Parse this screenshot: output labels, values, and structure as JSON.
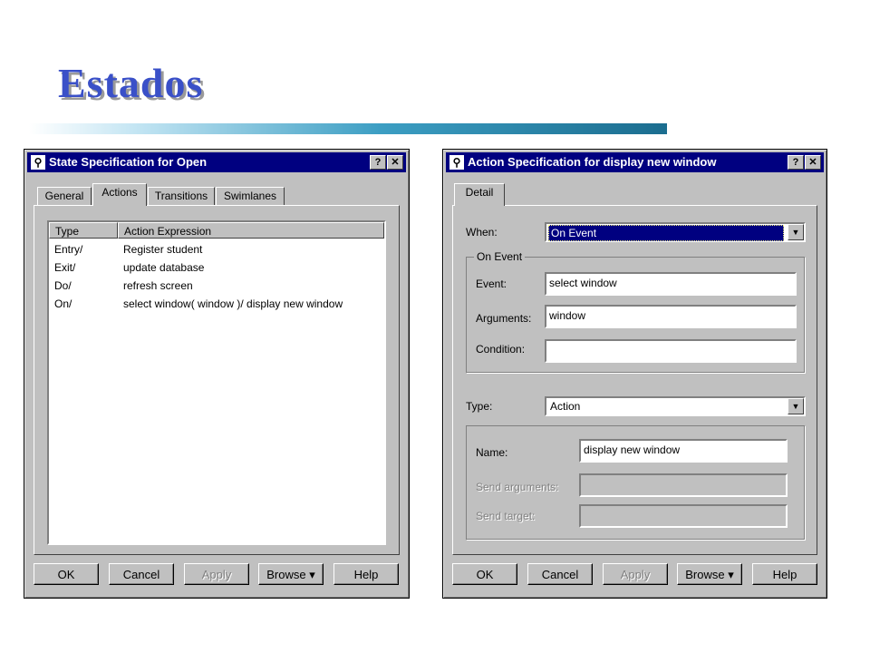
{
  "slide": {
    "title": "Estados"
  },
  "left_window": {
    "title": "State Specification for Open",
    "help_glyph": "?",
    "close_glyph": "✕",
    "tabs": [
      "General",
      "Actions",
      "Transitions",
      "Swimlanes"
    ],
    "active_tab": "Actions",
    "columns": [
      "Type",
      "Action Expression"
    ],
    "rows": [
      {
        "type": "Entry/",
        "expr": "Register student"
      },
      {
        "type": "Exit/",
        "expr": "update database"
      },
      {
        "type": "Do/",
        "expr": "refresh screen"
      },
      {
        "type": "On/",
        "expr": "select window( window )/ display new window"
      }
    ],
    "buttons": {
      "ok": "OK",
      "cancel": "Cancel",
      "apply": "Apply",
      "browse": "Browse ▾",
      "help": "Help"
    }
  },
  "right_window": {
    "title": "Action Specification for display new window",
    "help_glyph": "?",
    "close_glyph": "✕",
    "tabs": [
      "Detail"
    ],
    "when_label": "When:",
    "when_value": "On Event",
    "on_event_group": "On Event",
    "event_label": "Event:",
    "event_value": "select window",
    "arguments_label": "Arguments:",
    "arguments_value": "window",
    "condition_label": "Condition:",
    "condition_value": "",
    "type_label": "Type:",
    "type_value": "Action",
    "name_label": "Name:",
    "name_value": "display new window",
    "send_arguments_label": "Send arguments:",
    "send_target_label": "Send target:",
    "buttons": {
      "ok": "OK",
      "cancel": "Cancel",
      "apply": "Apply",
      "browse": "Browse ▾",
      "help": "Help"
    }
  },
  "colors": {
    "title": "#3a50c8",
    "titlebar": "#000080",
    "face": "#c0c0c0"
  }
}
